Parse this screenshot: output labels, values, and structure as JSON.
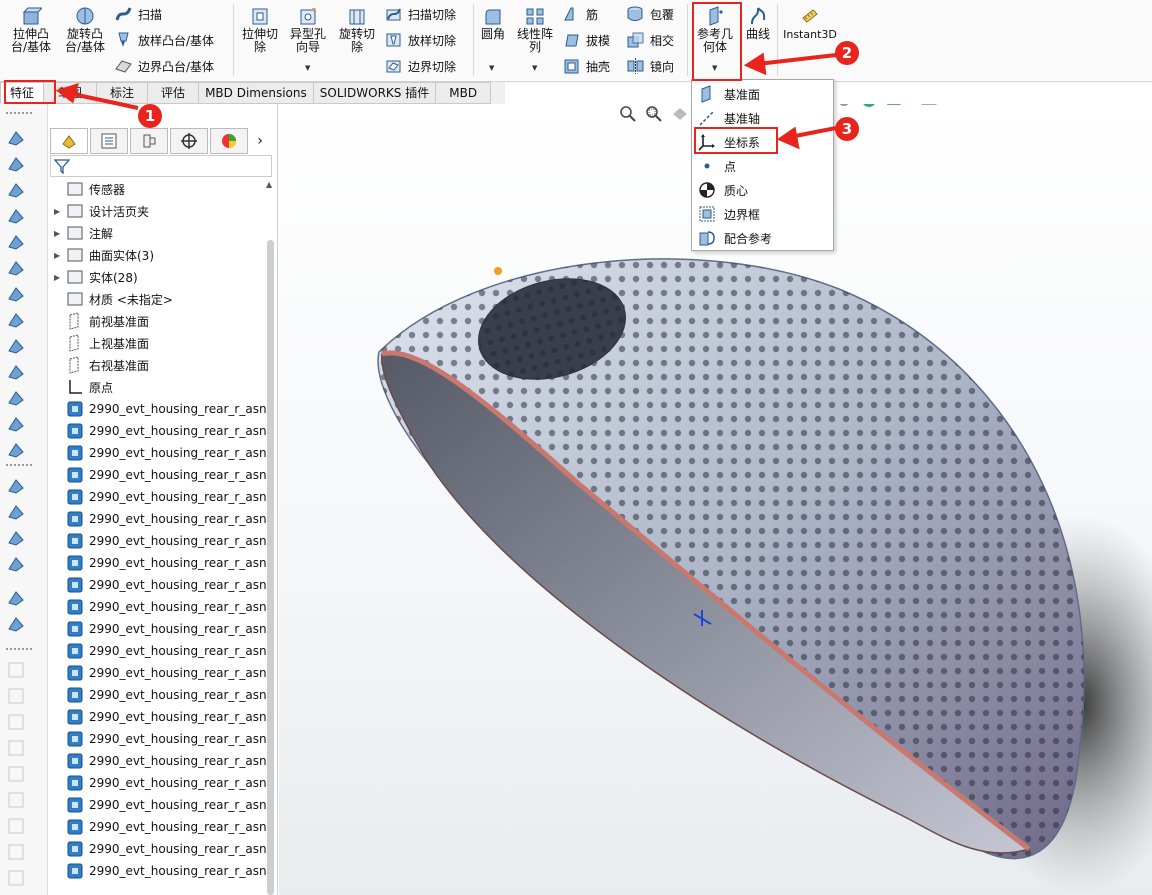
{
  "ribbon": {
    "extrude_boss": "拉伸凸\n台/基体",
    "revolve_boss": "旋转凸\n台/基体",
    "sweep": "扫描",
    "loft_boss": "放样凸台/基体",
    "boundary_boss": "边界凸台/基体",
    "extrude_cut": "拉伸切\n除",
    "hole_wizard": "异型孔\n向导",
    "revolve_cut": "旋转切\n除",
    "sweep_cut": "扫描切除",
    "loft_cut": "放样切除",
    "boundary_cut": "边界切除",
    "fillet": "圆角",
    "linear_pattern": "线性阵\n列",
    "rib": "筋",
    "draft": "拔模",
    "shell": "抽壳",
    "wrap": "包覆",
    "intersect": "相交",
    "mirror": "镜向",
    "ref_geometry": "参考几\n何体",
    "curves": "曲线",
    "instant3d": "Instant3D"
  },
  "tabs": [
    "特征",
    "草图",
    "标注",
    "评估",
    "MBD Dimensions",
    "SOLIDWORKS 插件",
    "MBD"
  ],
  "ref_menu": [
    "基准面",
    "基准轴",
    "坐标系",
    "点",
    "质心",
    "边界框",
    "配合参考"
  ],
  "tree": {
    "items": [
      "传感器",
      "设计活页夹",
      "注解",
      "曲面实体(3)",
      "实体(28)",
      "材质 <未指定>",
      "前视基准面",
      "上视基准面",
      "右视基准面",
      "原点"
    ],
    "part_name": "2990_evt_housing_rear_r_asn",
    "part_count": 22
  },
  "badges": [
    "1",
    "2",
    "3"
  ],
  "colors": {
    "highlight": "#e8241c",
    "accent_blue": "#1f6fc5"
  }
}
